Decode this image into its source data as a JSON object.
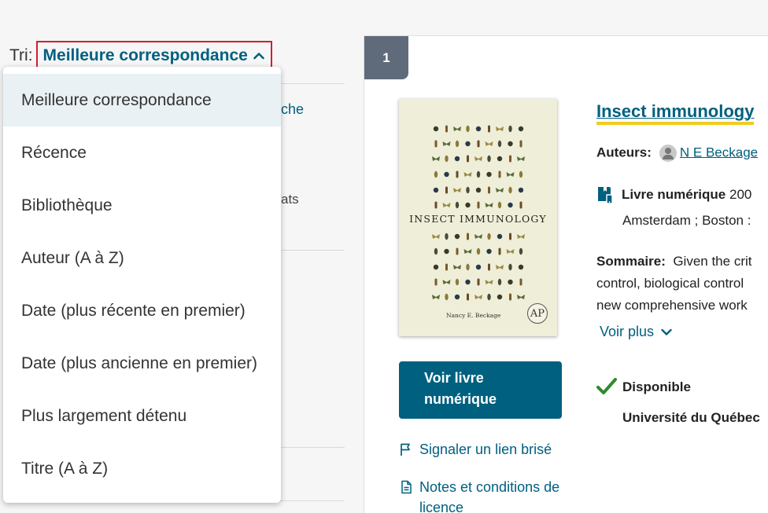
{
  "sort": {
    "label": "Tri:",
    "current": "Meilleure correspondance",
    "options": [
      "Meilleure correspondance",
      "Récence",
      "Bibliothèque",
      "Auteur (A à Z)",
      "Date (plus récente en premier)",
      "Date (plus ancienne en premier)",
      "Plus largement détenu",
      "Titre (A à Z)"
    ]
  },
  "sidebar": {
    "fragment_link": "che",
    "fragment_text": "ats"
  },
  "result": {
    "rank": "1",
    "title": "Insect immunology",
    "authors_label": "Auteurs:",
    "author": "N E Beckage",
    "format_label": "Livre numérique",
    "year": "200",
    "publisher": "Amsterdam ; Boston :",
    "summary_label": "Sommaire:",
    "summary_lines": [
      "Given the crit",
      "control, biological control",
      "new comprehensive work"
    ],
    "voir_plus": "Voir plus",
    "view_button": "Voir livre numérique",
    "report_link": "Signaler un lien brisé",
    "license_link": "Notes et conditions de licence",
    "availability": "Disponible",
    "institution": "Université du Québec",
    "cover": {
      "title": "INSECT IMMUNOLOGY",
      "author": "Nancy E. Beckage",
      "logo": "AP"
    }
  },
  "colors": {
    "accent": "#00607f",
    "highlight": "#f1cc1f",
    "focus_border": "#d01f2e",
    "available": "#2e8b2e",
    "badge": "#5f6b7a"
  }
}
